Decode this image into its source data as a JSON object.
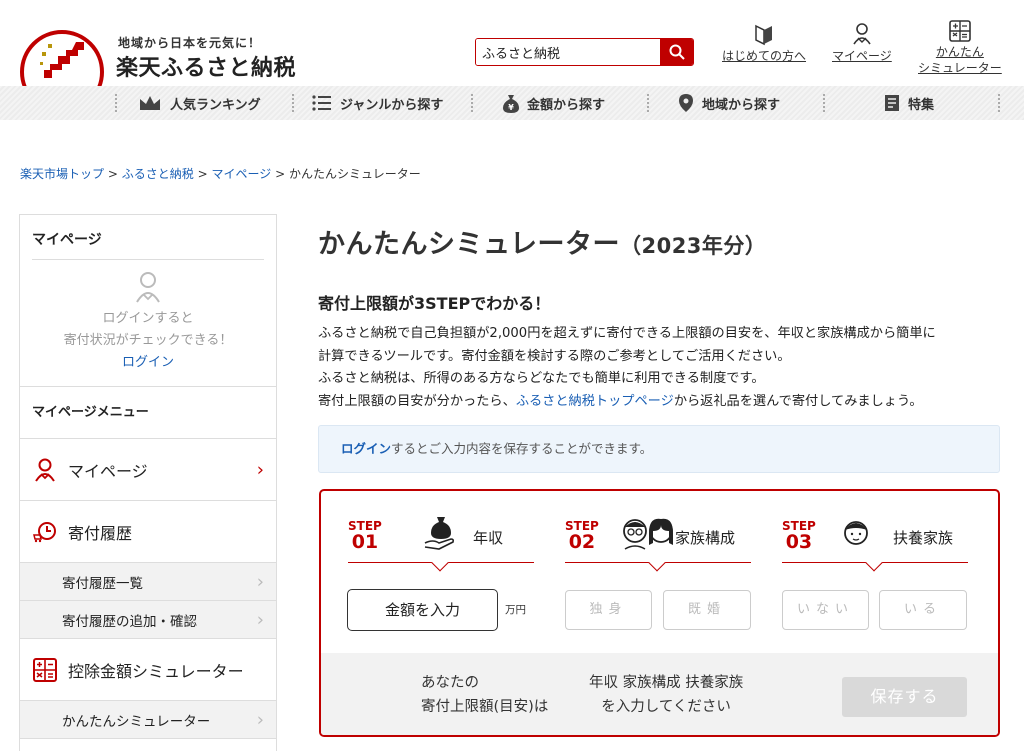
{
  "header": {
    "brand_sub": "地域から日本を元気に！",
    "brand_main": "楽天ふるさと納税",
    "search_value": "ふるさと納税",
    "nav": [
      {
        "label": "はじめての方へ",
        "icon": "beginner-icon"
      },
      {
        "label": "マイページ",
        "icon": "user-icon"
      },
      {
        "label1": "かんたん",
        "label2": "シミュレーター",
        "icon": "calculator-icon"
      }
    ]
  },
  "categories": [
    {
      "label": "人気ランキング",
      "icon": "crown-icon"
    },
    {
      "label": "ジャンルから探す",
      "icon": "list-icon"
    },
    {
      "label": "金額から探す",
      "icon": "yen-bag-icon"
    },
    {
      "label": "地域から探す",
      "icon": "map-pin-icon"
    },
    {
      "label": "特集",
      "icon": "document-icon"
    }
  ],
  "breadcrumb": {
    "items": [
      "楽天市場トップ",
      "ふるさと納税",
      "マイページ"
    ],
    "current": "かんたんシミュレーター",
    "sep": ">"
  },
  "sidebar": {
    "title": "マイページ",
    "login_line1": "ログインすると",
    "login_line2": "寄付状況がチェックできる！",
    "login_link": "ログイン",
    "menu_title": "マイページメニュー",
    "items": [
      {
        "label": "マイページ",
        "icon": "user-icon"
      },
      {
        "label": "寄付履歴",
        "icon": "history-icon"
      },
      {
        "label": "寄付履歴一覧"
      },
      {
        "label": "寄付履歴の追加・確認"
      },
      {
        "label": "控除金額シミュレーター",
        "icon": "calculator-icon"
      },
      {
        "label": "かんたんシミュレーター"
      }
    ]
  },
  "main": {
    "title": "かんたんシミュレーター",
    "title_year": "（2023年分）",
    "subtitle": "寄付上限額が3STEPでわかる！",
    "desc1": "ふるさと納税で自己負担額が2,000円を超えずに寄付できる上限額の目安を、年収と家族構成から簡単に",
    "desc2": "計算できるツールです。寄付金額を検討する際のご参考としてご活用ください。",
    "desc3": "ふるさと納税は、所得のある方ならどなたでも簡単に利用できる制度です。",
    "desc4_pre": "寄付上限額の目安が分かったら、",
    "desc4_link": "ふるさと納税トップページ",
    "desc4_post": "から返礼品を選んで寄付してみましょう。",
    "notice_link": "ログイン",
    "notice_text": "するとご入力内容を保存することができます。"
  },
  "simulator": {
    "steps": [
      {
        "step": "STEP",
        "num": "01",
        "label": "年収",
        "icon": "money-bag-icon"
      },
      {
        "step": "STEP",
        "num": "02",
        "label": "家族構成",
        "icon": "couple-icon"
      },
      {
        "step": "STEP",
        "num": "03",
        "label": "扶養家族",
        "icon": "child-icon"
      }
    ],
    "amount_button": "金額を入力",
    "unit": "万円",
    "family_options": [
      "独身",
      "既婚"
    ],
    "dependent_options": [
      "いない",
      "いる"
    ],
    "result_line1": "あなたの",
    "result_line2": "寄付上限額(目安)は",
    "result_msg1": "年収 家族構成 扶養家族",
    "result_msg2": "を入力してください",
    "save": "保存する"
  },
  "colors": {
    "accent": "#bf0000",
    "link": "#1a5fb4",
    "notice_bg": "#eef5fc"
  }
}
